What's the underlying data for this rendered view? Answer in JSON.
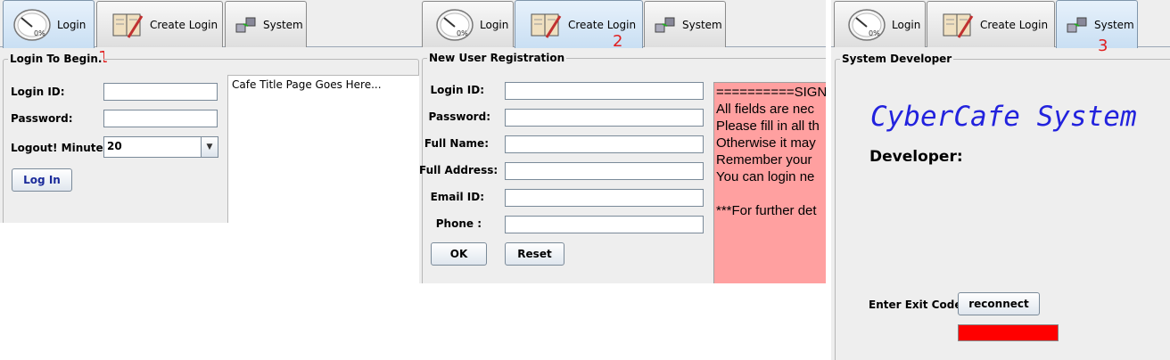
{
  "panel1": {
    "tabs": [
      {
        "label": "Login",
        "icon": "speedometer-icon",
        "gauge_text": "0%"
      },
      {
        "label": "Create Login",
        "icon": "notebook-pen-icon"
      },
      {
        "label": "System",
        "icon": "network-icon"
      }
    ],
    "marker": "1",
    "group_title": "Login To Begin.",
    "login_id_label": "Login ID:",
    "password_label": "Password:",
    "logout_label": "Logout! Minutes:",
    "logout_value": "20",
    "login_button": "Log In",
    "title_text": "Cafe Title Page Goes Here..."
  },
  "panel2": {
    "tabs": [
      {
        "label": "Login",
        "icon": "speedometer-icon",
        "gauge_text": "0%"
      },
      {
        "label": "Create Login",
        "icon": "notebook-pen-icon"
      },
      {
        "label": "System",
        "icon": "network-icon"
      }
    ],
    "marker": "2",
    "group_title": "New User Registration",
    "fields": [
      "Login ID:",
      "Password:",
      "Full Name:",
      "Full Address:",
      "Email ID:",
      "Phone :"
    ],
    "ok_button": "OK",
    "reset_button": "Reset",
    "info_lines": [
      "==========SIGN",
      "All fields are nec",
      "Please fill in all th",
      "Otherwise it may",
      "Remember your",
      "You can login ne",
      "",
      "***For further det"
    ]
  },
  "panel3": {
    "tabs": [
      {
        "label": "Login",
        "icon": "speedometer-icon",
        "gauge_text": "0%"
      },
      {
        "label": "Create Login",
        "icon": "notebook-pen-icon"
      },
      {
        "label": "System",
        "icon": "network-icon"
      }
    ],
    "marker": "3",
    "group_title": "System Developer",
    "brand_text": "CyberCafe System",
    "developer_label": "Developer:",
    "exit_code_label": "Enter Exit Code:",
    "reconnect_button": "reconnect"
  },
  "colors": {
    "selected_tab": "#c9dff3",
    "info_background": "#ffa0a0",
    "brand": "#2222dd",
    "status_bar": "#ff0000",
    "marker": "#e02020"
  }
}
